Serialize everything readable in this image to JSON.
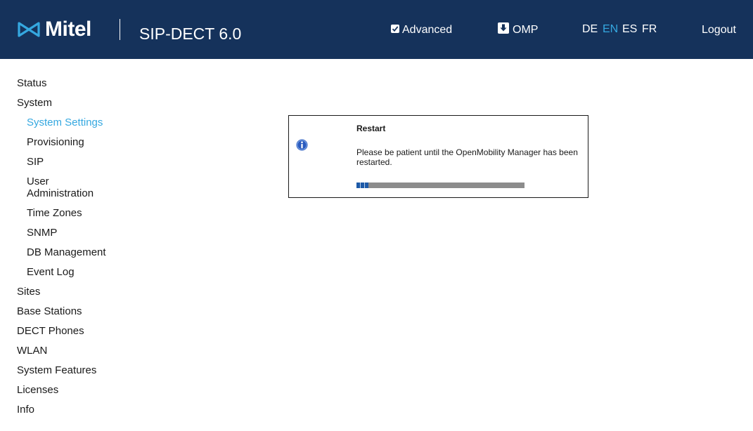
{
  "header": {
    "logo_text": "Mitel",
    "product": "SIP-DECT 6.0",
    "advanced_label": "Advanced",
    "advanced_checked": true,
    "omp_label": "OMP",
    "languages": [
      "DE",
      "EN",
      "ES",
      "FR"
    ],
    "active_language": "EN",
    "logout_label": "Logout",
    "colors": {
      "background": "#15325b",
      "accent": "#35a8e0"
    }
  },
  "sidebar": {
    "items": [
      {
        "label": "Status",
        "level": "top"
      },
      {
        "label": "System",
        "level": "top"
      },
      {
        "label": "System Settings",
        "level": "sub",
        "active": true
      },
      {
        "label": "Provisioning",
        "level": "sub"
      },
      {
        "label": "SIP",
        "level": "sub"
      },
      {
        "label": "User Administration",
        "level": "sub"
      },
      {
        "label": "Time Zones",
        "level": "sub"
      },
      {
        "label": "SNMP",
        "level": "sub"
      },
      {
        "label": "DB Management",
        "level": "sub"
      },
      {
        "label": "Event Log",
        "level": "sub"
      },
      {
        "label": "Sites",
        "level": "top"
      },
      {
        "label": "Base Stations",
        "level": "top"
      },
      {
        "label": "DECT Phones",
        "level": "top"
      },
      {
        "label": "WLAN",
        "level": "top"
      },
      {
        "label": "System Features",
        "level": "top"
      },
      {
        "label": "Licenses",
        "level": "top"
      },
      {
        "label": "Info",
        "level": "top"
      }
    ]
  },
  "dialog": {
    "icon": "info-icon",
    "title": "Restart",
    "message": "Please be patient until the OpenMobility Manager has been restarted.",
    "progress": 0.07
  }
}
